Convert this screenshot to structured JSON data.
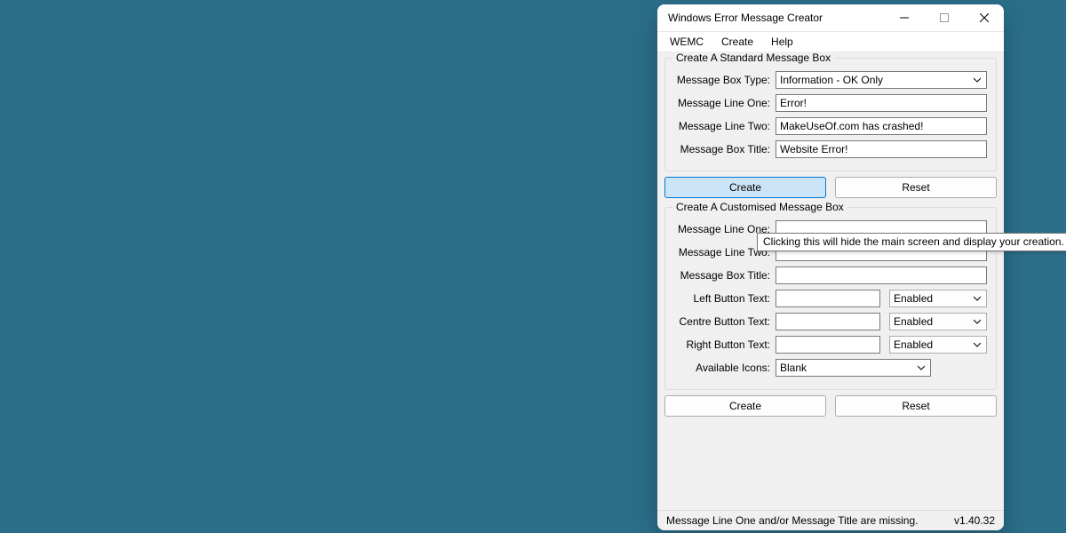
{
  "window": {
    "title": "Windows Error Message Creator"
  },
  "menu": {
    "items": [
      "WEMC",
      "Create",
      "Help"
    ]
  },
  "standard": {
    "legend": "Create A Standard Message Box",
    "labels": {
      "type": "Message Box Type:",
      "line1": "Message Line One:",
      "line2": "Message Line Two:",
      "title": "Message Box Title:"
    },
    "values": {
      "type": "Information - OK Only",
      "line1": "Error!",
      "line2": "MakeUseOf.com has crashed!",
      "title": "Website Error!"
    },
    "buttons": {
      "create": "Create",
      "reset": "Reset"
    }
  },
  "custom": {
    "legend": "Create A Customised Message Box",
    "labels": {
      "line1": "Message Line One:",
      "line2": "Message Line Two:",
      "title": "Message Box Title:",
      "leftbtn": "Left Button Text:",
      "centrebtn": "Centre Button Text:",
      "rightbtn": "Right Button Text:",
      "icons": "Available Icons:"
    },
    "values": {
      "line1": "",
      "line2": "",
      "title": "",
      "leftbtn_text": "",
      "leftbtn_state": "Enabled",
      "centrebtn_text": "",
      "centrebtn_state": "Enabled",
      "rightbtn_text": "",
      "rightbtn_state": "Enabled",
      "icons": "Blank"
    },
    "buttons": {
      "create": "Create",
      "reset": "Reset"
    }
  },
  "tooltip": "Clicking this will hide the main screen and display your creation.",
  "status": {
    "message": "Message Line One and/or Message Title are missing.",
    "version": "v1.40.32"
  }
}
